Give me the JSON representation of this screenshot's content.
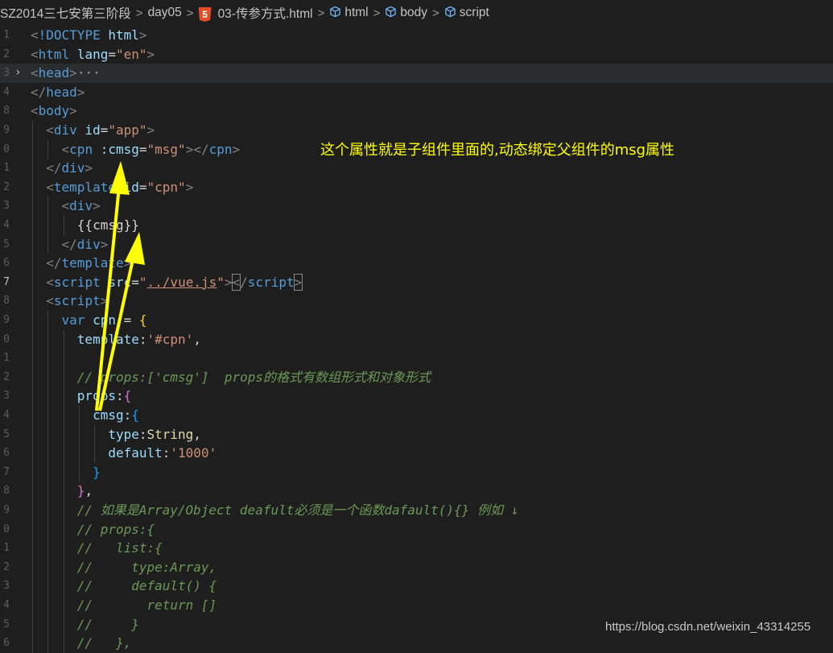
{
  "breadcrumb": {
    "items": [
      {
        "label": "SZ2014三七安第三阶段"
      },
      {
        "label": "day05"
      },
      {
        "label": "03-传参方式.html",
        "icon": "html5-icon",
        "badge": "5"
      },
      {
        "label": "html",
        "icon": "cube-icon"
      },
      {
        "label": "body",
        "icon": "cube-icon"
      },
      {
        "label": "script",
        "icon": "cube-icon"
      }
    ],
    "separator": ">"
  },
  "editor": {
    "lines": [
      {
        "num": "1",
        "tokens": [
          {
            "t": "<",
            "c": "p"
          },
          {
            "t": "!DOCTYPE ",
            "c": "t"
          },
          {
            "t": "html",
            "c": "a"
          },
          {
            "t": ">",
            "c": "p"
          }
        ]
      },
      {
        "num": "2",
        "tokens": [
          {
            "t": "<",
            "c": "p"
          },
          {
            "t": "html ",
            "c": "t"
          },
          {
            "t": "lang",
            "c": "a"
          },
          {
            "t": "=",
            "c": "x"
          },
          {
            "t": "\"en\"",
            "c": "s"
          },
          {
            "t": ">",
            "c": "p"
          }
        ]
      },
      {
        "num": "3",
        "fold": "›",
        "tokens": [
          {
            "t": "<",
            "c": "p"
          },
          {
            "t": "head",
            "c": "t"
          },
          {
            "t": ">",
            "c": "p"
          },
          {
            "t": "···",
            "c": "ellipsis"
          }
        ]
      },
      {
        "num": "4",
        "tokens": [
          {
            "t": "</",
            "c": "p"
          },
          {
            "t": "head",
            "c": "t"
          },
          {
            "t": ">",
            "c": "p"
          }
        ]
      },
      {
        "num": "8",
        "tokens": [
          {
            "t": "<",
            "c": "p"
          },
          {
            "t": "body",
            "c": "t"
          },
          {
            "t": ">",
            "c": "p"
          }
        ]
      },
      {
        "num": "9",
        "tokens": [
          {
            "t": "  ",
            "c": "x"
          },
          {
            "t": "<",
            "c": "p"
          },
          {
            "t": "div ",
            "c": "t"
          },
          {
            "t": "id",
            "c": "a"
          },
          {
            "t": "=",
            "c": "x"
          },
          {
            "t": "\"app\"",
            "c": "s"
          },
          {
            "t": ">",
            "c": "p"
          }
        ]
      },
      {
        "num": "0",
        "tokens": [
          {
            "t": "    ",
            "c": "x"
          },
          {
            "t": "<",
            "c": "p"
          },
          {
            "t": "cpn ",
            "c": "t"
          },
          {
            "t": ":cmsg",
            "c": "a"
          },
          {
            "t": "=",
            "c": "x"
          },
          {
            "t": "\"msg\"",
            "c": "s"
          },
          {
            "t": "></",
            "c": "p"
          },
          {
            "t": "cpn",
            "c": "t"
          },
          {
            "t": ">",
            "c": "p"
          }
        ]
      },
      {
        "num": "1",
        "tokens": [
          {
            "t": "  ",
            "c": "x"
          },
          {
            "t": "</",
            "c": "p"
          },
          {
            "t": "div",
            "c": "t"
          },
          {
            "t": ">",
            "c": "p"
          }
        ]
      },
      {
        "num": "2",
        "tokens": [
          {
            "t": "  ",
            "c": "x"
          },
          {
            "t": "<",
            "c": "p"
          },
          {
            "t": "template ",
            "c": "t"
          },
          {
            "t": "id",
            "c": "a"
          },
          {
            "t": "=",
            "c": "x"
          },
          {
            "t": "\"cpn\"",
            "c": "s"
          },
          {
            "t": ">",
            "c": "p"
          }
        ]
      },
      {
        "num": "3",
        "tokens": [
          {
            "t": "    ",
            "c": "x"
          },
          {
            "t": "<",
            "c": "p"
          },
          {
            "t": "div",
            "c": "t"
          },
          {
            "t": ">",
            "c": "p"
          }
        ]
      },
      {
        "num": "4",
        "tokens": [
          {
            "t": "      ",
            "c": "x"
          },
          {
            "t": "{{cmsg}}",
            "c": "x"
          }
        ]
      },
      {
        "num": "5",
        "tokens": [
          {
            "t": "    ",
            "c": "x"
          },
          {
            "t": "</",
            "c": "p"
          },
          {
            "t": "div",
            "c": "t"
          },
          {
            "t": ">",
            "c": "p"
          }
        ]
      },
      {
        "num": "6",
        "tokens": [
          {
            "t": "  ",
            "c": "x"
          },
          {
            "t": "</",
            "c": "p"
          },
          {
            "t": "template",
            "c": "t"
          },
          {
            "t": ">",
            "c": "p"
          }
        ]
      },
      {
        "num": "7",
        "active": true,
        "tokens": [
          {
            "t": "  ",
            "c": "x"
          },
          {
            "t": "<",
            "c": "p"
          },
          {
            "t": "script ",
            "c": "t"
          },
          {
            "t": "src",
            "c": "a"
          },
          {
            "t": "=",
            "c": "x"
          },
          {
            "t": "\"",
            "c": "s"
          },
          {
            "t": "../vue.js",
            "c": "s u"
          },
          {
            "t": "\"",
            "c": "s"
          },
          {
            "t": ">",
            "c": "p"
          },
          {
            "t": "<",
            "c": "p bmatch"
          },
          {
            "t": "/",
            "c": "p"
          },
          {
            "t": "script",
            "c": "t"
          },
          {
            "t": ">",
            "c": "p bmatch"
          }
        ]
      },
      {
        "num": "8",
        "tokens": [
          {
            "t": "  ",
            "c": "x"
          },
          {
            "t": "<",
            "c": "p"
          },
          {
            "t": "script",
            "c": "t"
          },
          {
            "t": ">",
            "c": "p"
          }
        ]
      },
      {
        "num": "9",
        "tokens": [
          {
            "t": "    ",
            "c": "x"
          },
          {
            "t": "var ",
            "c": "k"
          },
          {
            "t": "cpn",
            "c": "v"
          },
          {
            "t": " = ",
            "c": "x"
          },
          {
            "t": "{",
            "c": "br"
          }
        ]
      },
      {
        "num": "0",
        "tokens": [
          {
            "t": "      ",
            "c": "x"
          },
          {
            "t": "template",
            "c": "a"
          },
          {
            "t": ":",
            "c": "x"
          },
          {
            "t": "'#cpn'",
            "c": "s"
          },
          {
            "t": ",",
            "c": "x"
          }
        ]
      },
      {
        "num": "1",
        "tokens": []
      },
      {
        "num": "2",
        "tokens": [
          {
            "t": "      ",
            "c": "x"
          },
          {
            "t": "// props:['cmsg']  props的格式有数组形式和对象形式",
            "c": "c"
          }
        ]
      },
      {
        "num": "3",
        "tokens": [
          {
            "t": "      ",
            "c": "x"
          },
          {
            "t": "props",
            "c": "a"
          },
          {
            "t": ":",
            "c": "x"
          },
          {
            "t": "{",
            "c": "bp"
          }
        ]
      },
      {
        "num": "4",
        "tokens": [
          {
            "t": "        ",
            "c": "x"
          },
          {
            "t": "cmsg",
            "c": "a"
          },
          {
            "t": ":",
            "c": "x"
          },
          {
            "t": "{",
            "c": "bb"
          }
        ]
      },
      {
        "num": "5",
        "tokens": [
          {
            "t": "          ",
            "c": "x"
          },
          {
            "t": "type",
            "c": "a"
          },
          {
            "t": ":",
            "c": "x"
          },
          {
            "t": "String",
            "c": "y"
          },
          {
            "t": ",",
            "c": "x"
          }
        ]
      },
      {
        "num": "6",
        "tokens": [
          {
            "t": "          ",
            "c": "x"
          },
          {
            "t": "default",
            "c": "a"
          },
          {
            "t": ":",
            "c": "x"
          },
          {
            "t": "'1000'",
            "c": "s"
          }
        ]
      },
      {
        "num": "7",
        "tokens": [
          {
            "t": "        ",
            "c": "x"
          },
          {
            "t": "}",
            "c": "bb"
          }
        ]
      },
      {
        "num": "8",
        "tokens": [
          {
            "t": "      ",
            "c": "x"
          },
          {
            "t": "}",
            "c": "bp"
          },
          {
            "t": ",",
            "c": "x"
          }
        ]
      },
      {
        "num": "9",
        "tokens": [
          {
            "t": "      ",
            "c": "x"
          },
          {
            "t": "// 如果是Array/Object deafult必须是一个函数dafault(){} 例如 ↓",
            "c": "c"
          }
        ]
      },
      {
        "num": "0",
        "tokens": [
          {
            "t": "      ",
            "c": "x"
          },
          {
            "t": "// props:{",
            "c": "c"
          }
        ]
      },
      {
        "num": "1",
        "tokens": [
          {
            "t": "      ",
            "c": "x"
          },
          {
            "t": "//   list:{",
            "c": "c"
          }
        ]
      },
      {
        "num": "2",
        "tokens": [
          {
            "t": "      ",
            "c": "x"
          },
          {
            "t": "//     type:Array,",
            "c": "c"
          }
        ]
      },
      {
        "num": "3",
        "tokens": [
          {
            "t": "      ",
            "c": "x"
          },
          {
            "t": "//     default() {",
            "c": "c"
          }
        ]
      },
      {
        "num": "4",
        "tokens": [
          {
            "t": "      ",
            "c": "x"
          },
          {
            "t": "//       return []",
            "c": "c"
          }
        ]
      },
      {
        "num": "5",
        "tokens": [
          {
            "t": "      ",
            "c": "x"
          },
          {
            "t": "//     }",
            "c": "c"
          }
        ]
      },
      {
        "num": "6",
        "tokens": [
          {
            "t": "      ",
            "c": "x"
          },
          {
            "t": "//   },",
            "c": "c"
          }
        ]
      }
    ]
  },
  "annotation": {
    "text": "这个属性就是子组件里面的,动态绑定父组件的msg属性",
    "color": "#ffff00"
  },
  "watermark": {
    "text": "https://blog.csdn.net/weixin_43314255"
  },
  "colors": {
    "background": "#1e1e1e",
    "tag": "#569cd6",
    "attribute": "#9cdcfe",
    "string": "#ce9178",
    "comment": "#6a9955",
    "arrow": "#ffff00"
  }
}
